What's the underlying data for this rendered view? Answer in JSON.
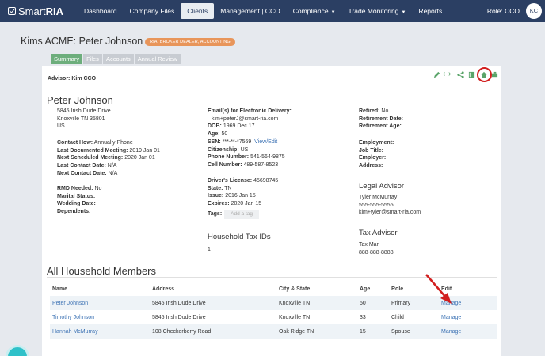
{
  "brand": {
    "name_light": "Smart",
    "name_bold": "RIA"
  },
  "nav": {
    "links": [
      "Dashboard",
      "Company Files",
      "Clients",
      "Management | CCO",
      "Compliance",
      "Trade Monitoring",
      "Reports"
    ],
    "role": "Role: CCO",
    "avatar_initials": "KC"
  },
  "header": {
    "title": "Kims ACME: Peter Johnson",
    "badge": "RIA, BROKER DEALER, ACCOUNTING",
    "tabs": [
      "Summary",
      "Files",
      "Accounts",
      "Annual Review"
    ]
  },
  "card": {
    "advisor": "Advisor: Kim CCO",
    "client_name": "Peter Johnson",
    "address": [
      "5845 Irish Dude Drive",
      "Knoxville TN 35801",
      "US"
    ],
    "contact": [
      {
        "label": "Contact How:",
        "value": "Annually Phone"
      },
      {
        "label": "Last Documented Meeting:",
        "value": "2019 Jan 01"
      },
      {
        "label": "Next Scheduled Meeting:",
        "value": "2020 Jan 01"
      },
      {
        "label": "Last Contact Date:",
        "value": "N/A"
      },
      {
        "label": "Next Contact Date:",
        "value": "N/A"
      }
    ],
    "misc": [
      {
        "label": "RMD Needed:",
        "value": "No"
      },
      {
        "label": "Marital Status:",
        "value": ""
      },
      {
        "label": "Wedding Date:",
        "value": ""
      },
      {
        "label": "Dependents:",
        "value": ""
      }
    ],
    "email_label": "Email(s) for Electronic Delivery:",
    "email": "kim+peterJ@smart-ria.com",
    "personal": [
      {
        "label": "DOB:",
        "value": "1969 Dec 17"
      },
      {
        "label": "Age:",
        "value": "50"
      }
    ],
    "ssn_label": "SSN:",
    "ssn_value": "***-**-*7569",
    "ssn_link": "View/Edit",
    "personal2": [
      {
        "label": "Citizenship:",
        "value": "US"
      },
      {
        "label": "Phone Number:",
        "value": "541-564-9875"
      },
      {
        "label": "Cell Number:",
        "value": "489-587-8523"
      }
    ],
    "license": [
      {
        "label": "Driver's License:",
        "value": "45698745"
      },
      {
        "label": "State:",
        "value": "TN"
      },
      {
        "label": "Issue:",
        "value": "2016 Jan 15"
      },
      {
        "label": "Expires:",
        "value": "2020 Jan 15"
      }
    ],
    "tags_label": "Tags:",
    "tags_placeholder": "Add a tag",
    "household_tax_title": "Household Tax IDs",
    "household_tax_value": "1",
    "retired": [
      {
        "label": "Retired:",
        "value": "No"
      },
      {
        "label": "Retirement Date:",
        "value": ""
      },
      {
        "label": "Retirement Age:",
        "value": ""
      }
    ],
    "employment": [
      {
        "label": "Employment:",
        "value": ""
      },
      {
        "label": "Job Title:",
        "value": ""
      },
      {
        "label": "Employer:",
        "value": ""
      },
      {
        "label": "Address:",
        "value": ""
      }
    ],
    "legal_title": "Legal Advisor",
    "legal": [
      "Tyler McMurray",
      "555-555-5555",
      "kim+tyler@smart-ria.com"
    ],
    "tax_title": "Tax Advisor",
    "tax": [
      "Tax Man",
      "888-888-8888"
    ]
  },
  "household": {
    "title": "All Household Members",
    "columns": [
      "Name",
      "Address",
      "City & State",
      "Age",
      "Role",
      "Edit"
    ],
    "rows": [
      {
        "name": "Peter Johnson",
        "address": "5845 Irish Dude Drive",
        "city": "Knoxville TN",
        "age": "50",
        "role": "Primary",
        "edit": "Manage"
      },
      {
        "name": "Timothy Johnson",
        "address": "5845 Irish Dude Drive",
        "city": "Knoxville TN",
        "age": "33",
        "role": "Child",
        "edit": "Manage"
      },
      {
        "name": "Hannah McMurray",
        "address": "108 Checkerberry Road",
        "city": "Oak Ridge TN",
        "age": "15",
        "role": "Spouse",
        "edit": "Manage"
      }
    ]
  },
  "colors": {
    "nav": "#2b3f63",
    "accent_green": "#6dae7c",
    "badge": "#e8955a",
    "link": "#3f74b5",
    "annotation_red": "#d21f1f"
  },
  "icons": [
    "pencil-icon",
    "prev-icon",
    "next-icon",
    "share-icon",
    "book-icon",
    "home-icon",
    "print-icon"
  ]
}
